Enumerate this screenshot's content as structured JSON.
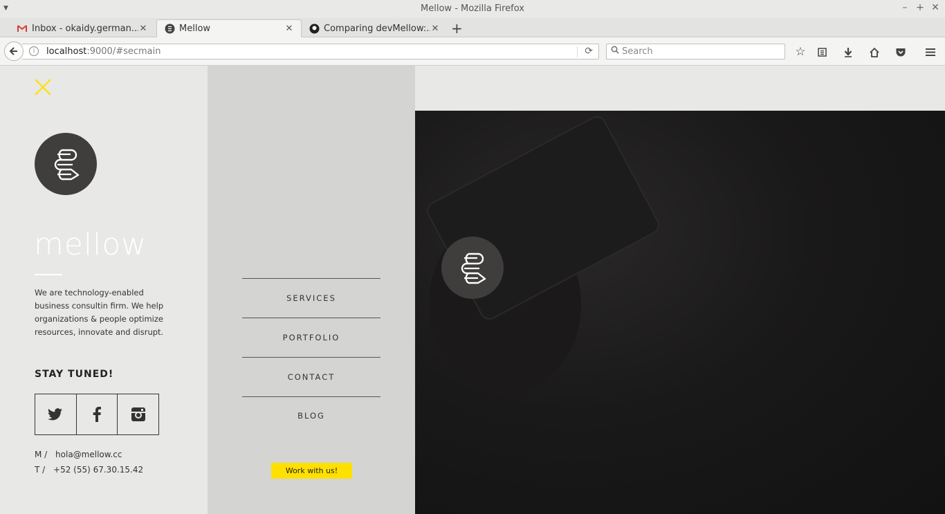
{
  "window": {
    "title": "Mellow - Mozilla Firefox"
  },
  "tabs": [
    {
      "label": "Inbox - okaidy.german...",
      "icon": "gmail-icon"
    },
    {
      "label": "Mellow",
      "icon": "mellow-favicon"
    },
    {
      "label": "Comparing devMellow:...",
      "icon": "github-icon"
    }
  ],
  "navbar": {
    "url_host": "localhost",
    "url_rest": ":9000/#secmain",
    "search_placeholder": "Search"
  },
  "colors": {
    "accent": "#ffe000",
    "left_panel": "#e8e8e7",
    "mid_panel": "#d4d4d3",
    "logo_circle": "#3f3e3d"
  },
  "sidebar": {
    "brand": "mellow",
    "tagline": "We are technology-enabled business consultin firm. We help organizations & people optimize resources, innovate and disrupt.",
    "stay_tuned": "STAY TUNED!",
    "social": [
      "twitter-icon",
      "facebook-icon",
      "instagram-icon"
    ],
    "contact": [
      {
        "key": "M /",
        "value": "hola@mellow.cc"
      },
      {
        "key": "T /",
        "value": "+52 (55) 67.30.15.42"
      }
    ]
  },
  "menu": {
    "items": [
      "SERVICES",
      "PORTFOLIO",
      "CONTACT",
      "BLOG"
    ],
    "cta": "Work with us!"
  }
}
